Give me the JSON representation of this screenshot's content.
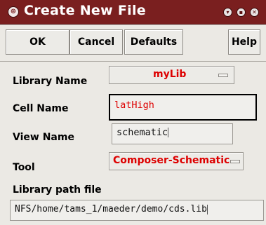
{
  "window": {
    "title": "Create New File",
    "title_icon": "cadence-icon",
    "controls": [
      "minimize-icon",
      "maximize-icon",
      "close-icon"
    ]
  },
  "toolbar": {
    "ok_label": "OK",
    "cancel_label": "Cancel",
    "defaults_label": "Defaults",
    "help_label": "Help"
  },
  "form": {
    "library_name": {
      "label": "Library Name",
      "value": "myLib"
    },
    "cell_name": {
      "label": "Cell Name",
      "value": "latHigh"
    },
    "view_name": {
      "label": "View Name",
      "value": "schematic"
    },
    "tool": {
      "label": "Tool",
      "value": "Composer-Schematic"
    },
    "library_path": {
      "label": "Library path file",
      "value": "NFS/home/tams_1/maeder/demo/cds.lib"
    }
  },
  "colors": {
    "titlebar": "#7a1f1f",
    "accent_red": "#dd0000",
    "background": "#ebe9e4"
  }
}
